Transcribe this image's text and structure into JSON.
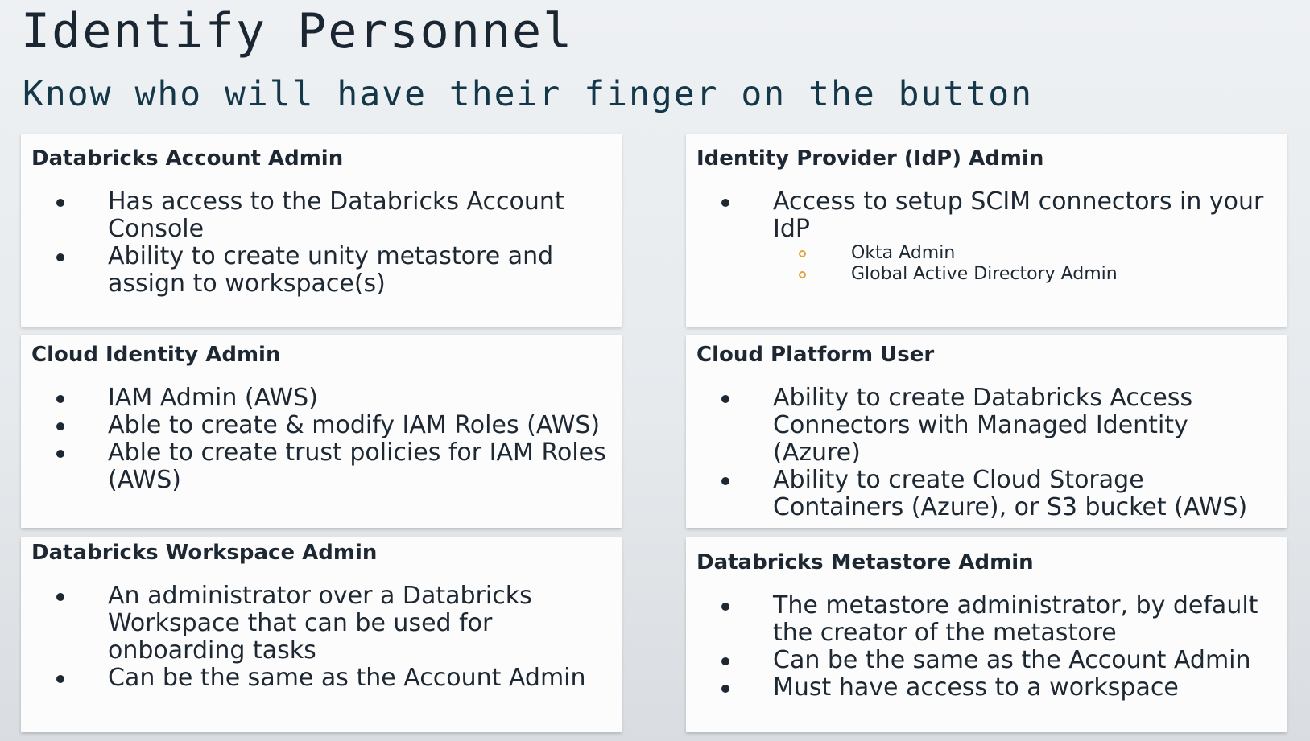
{
  "title": "Identify Personnel",
  "subtitle": "Know who will have their finger on the button",
  "cards": [
    {
      "title": "Databricks Account Admin",
      "items": [
        {
          "text": "Has access to the Databricks Account Console"
        },
        {
          "text": "Ability to create unity metastore and assign to workspace(s)"
        }
      ]
    },
    {
      "title": "Identity Provider (IdP) Admin",
      "items": [
        {
          "text": "Access to setup SCIM connectors in your IdP"
        }
      ],
      "subitems": [
        "Okta Admin",
        "Global Active Directory Admin"
      ]
    },
    {
      "title": "Cloud Identity Admin",
      "items": [
        {
          "text": "IAM Admin (AWS)"
        },
        {
          "text": "Able to create & modify IAM Roles (AWS)"
        },
        {
          "text": "Able to create trust policies for IAM Roles (AWS)"
        }
      ]
    },
    {
      "title": "Cloud Platform User",
      "items": [
        {
          "text": "Ability to create Databricks Access Connectors with Managed Identity (Azure)"
        },
        {
          "text": "Ability to create Cloud Storage Containers (Azure), or S3 bucket (AWS)"
        }
      ]
    },
    {
      "title": "Databricks Workspace Admin",
      "items": [
        {
          "text": "An administrator over a Databricks Workspace that can be used for onboarding tasks"
        },
        {
          "text": "Can be the same as the Account Admin"
        }
      ]
    },
    {
      "title": "Databricks Metastore Admin",
      "items": [
        {
          "text": "The metastore administrator, by default the creator of the metastore"
        },
        {
          "text": "Can be the same as the Account Admin"
        },
        {
          "text": "Must have access to a workspace"
        }
      ]
    }
  ],
  "colors": {
    "title": "#1a2632",
    "subtitle": "#14384a",
    "sub_bullet": "#e3a23b"
  }
}
